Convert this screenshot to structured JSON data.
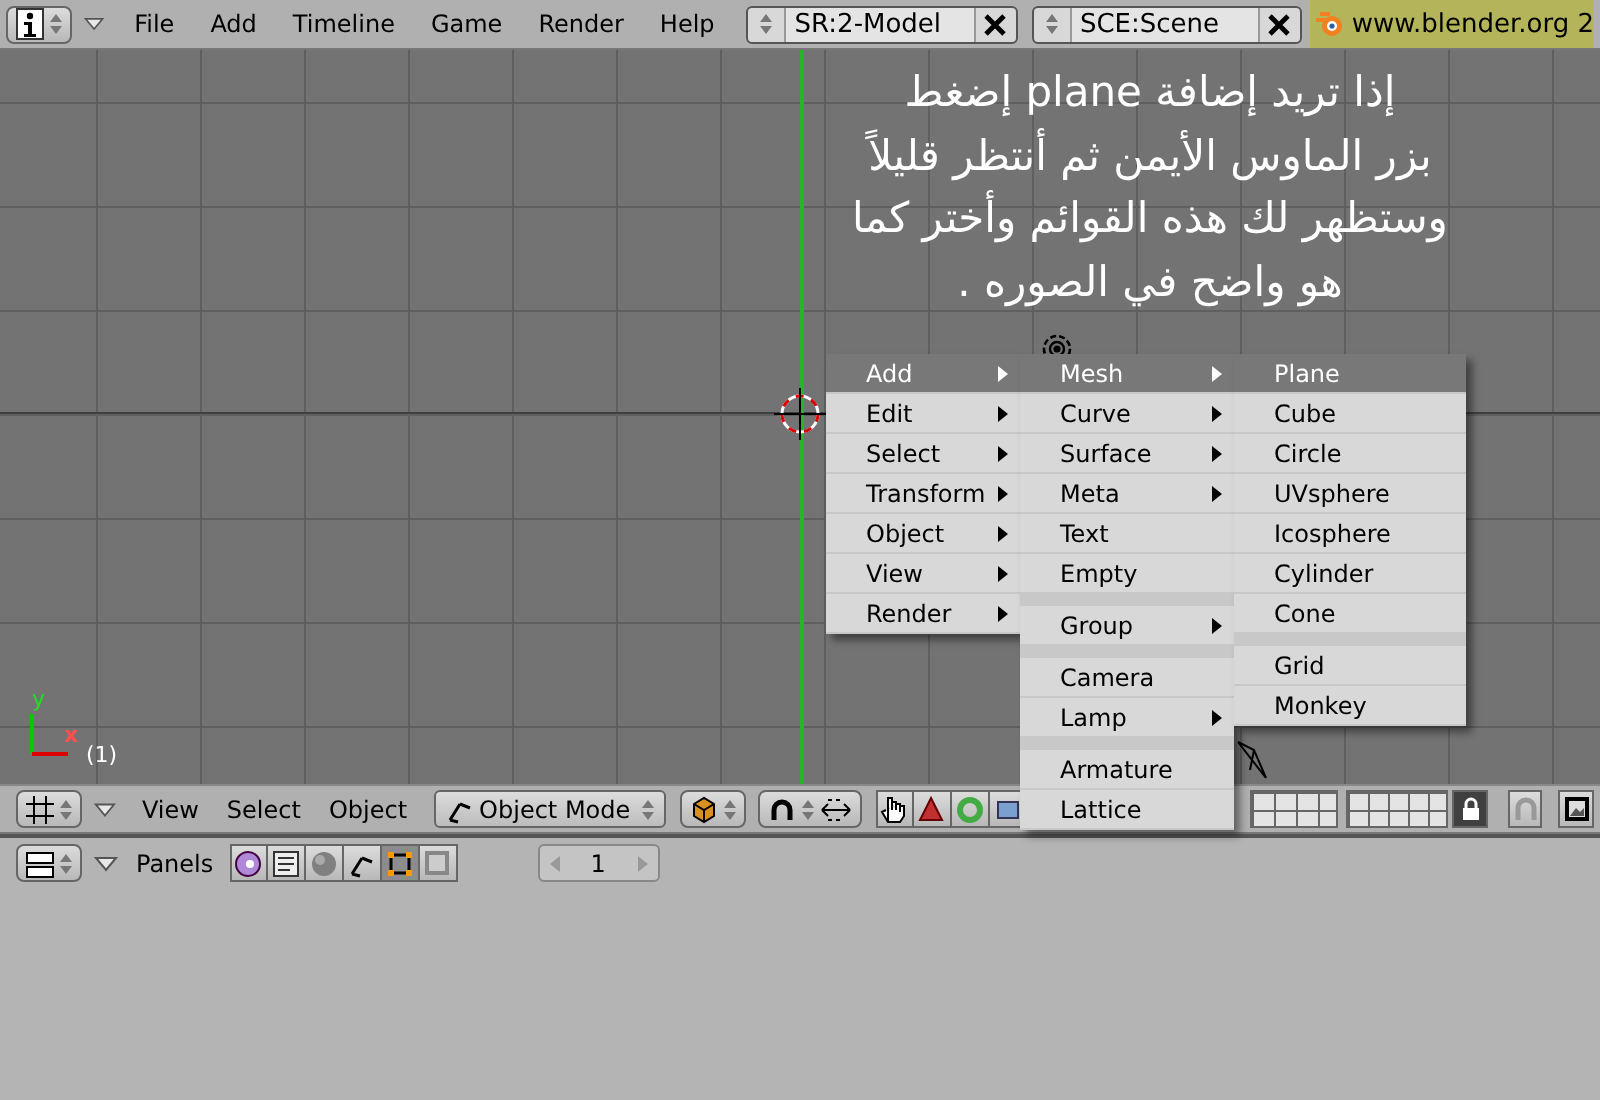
{
  "top_bar": {
    "menus": [
      "File",
      "Add",
      "Timeline",
      "Game",
      "Render",
      "Help"
    ],
    "screen_field": "SR:2-Model",
    "scene_field": "SCE:Scene",
    "link": "www.blender.org 2"
  },
  "viewport": {
    "annotation_lines": [
      "إذا تريد إضافة plane إضغط",
      "بزر الماوس الأيمن ثم أنتظر قليلاً",
      "وستظهر لك هذه القوائم وأختر كما",
      "هو واضح في الصوره ."
    ],
    "axis_labels": {
      "x": "x",
      "y": "y"
    },
    "frame_number": "(1)"
  },
  "menus": [
    {
      "items": [
        {
          "label": "Add",
          "submenu": true,
          "selected": true,
          "separator_before": false
        },
        {
          "label": "Edit",
          "submenu": true,
          "selected": false,
          "separator_before": false
        },
        {
          "label": "Select",
          "submenu": true,
          "selected": false,
          "separator_before": false
        },
        {
          "label": "Transform",
          "submenu": true,
          "selected": false,
          "separator_before": false
        },
        {
          "label": "Object",
          "submenu": true,
          "selected": false,
          "separator_before": false
        },
        {
          "label": "View",
          "submenu": true,
          "selected": false,
          "separator_before": false
        },
        {
          "label": "Render",
          "submenu": true,
          "selected": false,
          "separator_before": false
        }
      ]
    },
    {
      "items": [
        {
          "label": "Mesh",
          "submenu": true,
          "selected": true,
          "separator_before": false
        },
        {
          "label": "Curve",
          "submenu": true,
          "selected": false,
          "separator_before": false
        },
        {
          "label": "Surface",
          "submenu": true,
          "selected": false,
          "separator_before": false
        },
        {
          "label": "Meta",
          "submenu": true,
          "selected": false,
          "separator_before": false
        },
        {
          "label": "Text",
          "submenu": false,
          "selected": false,
          "separator_before": false
        },
        {
          "label": "Empty",
          "submenu": false,
          "selected": false,
          "separator_before": false
        },
        {
          "label": "Group",
          "submenu": true,
          "selected": false,
          "separator_before": true
        },
        {
          "label": "Camera",
          "submenu": false,
          "selected": false,
          "separator_before": true
        },
        {
          "label": "Lamp",
          "submenu": true,
          "selected": false,
          "separator_before": false
        },
        {
          "label": "Armature",
          "submenu": false,
          "selected": false,
          "separator_before": true
        },
        {
          "label": "Lattice",
          "submenu": false,
          "selected": false,
          "separator_before": false
        }
      ]
    },
    {
      "items": [
        {
          "label": "Plane",
          "submenu": false,
          "selected": true,
          "separator_before": false
        },
        {
          "label": "Cube",
          "submenu": false,
          "selected": false,
          "separator_before": false
        },
        {
          "label": "Circle",
          "submenu": false,
          "selected": false,
          "separator_before": false
        },
        {
          "label": "UVsphere",
          "submenu": false,
          "selected": false,
          "separator_before": false
        },
        {
          "label": "Icosphere",
          "submenu": false,
          "selected": false,
          "separator_before": false
        },
        {
          "label": "Cylinder",
          "submenu": false,
          "selected": false,
          "separator_before": false
        },
        {
          "label": "Cone",
          "submenu": false,
          "selected": false,
          "separator_before": false
        },
        {
          "label": "Grid",
          "submenu": false,
          "selected": false,
          "separator_before": true
        },
        {
          "label": "Monkey",
          "submenu": false,
          "selected": false,
          "separator_before": false
        }
      ]
    }
  ],
  "view_header": {
    "menus": [
      "View",
      "Select",
      "Object"
    ],
    "mode": "Object Mode"
  },
  "buttons_header": {
    "label": "Panels",
    "frame_field": "1"
  }
}
